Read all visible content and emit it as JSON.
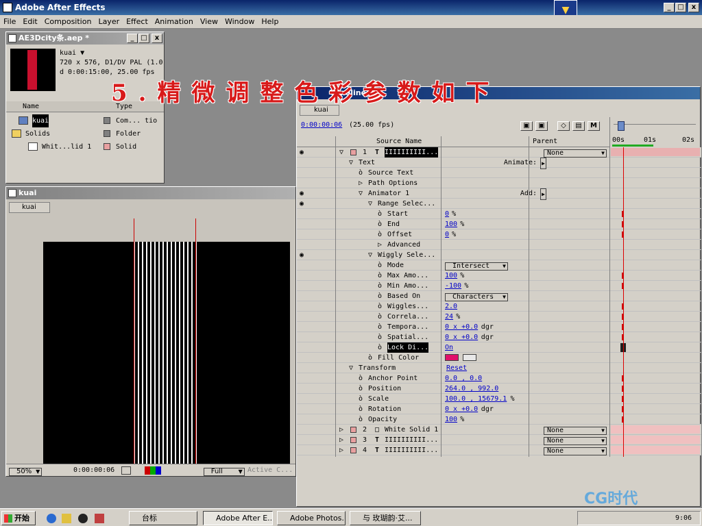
{
  "app": {
    "title": "Adobe After Effects"
  },
  "menu": [
    "File",
    "Edit",
    "Composition",
    "Layer",
    "Effect",
    "Animation",
    "View",
    "Window",
    "Help"
  ],
  "overlay_caption": "5.精微调整色彩参数如下",
  "project": {
    "title": "AE3Dcity条.aep *",
    "comp_name": "kuai ▼",
    "comp_info1": "720 x 576, D1/DV PAL (1.0",
    "comp_info2": "d 0:00:15:00, 25.00 fps",
    "col_name": "Name",
    "col_type": "Type",
    "items": [
      {
        "name": "kuai",
        "type": "Com... tio"
      },
      {
        "name": "Solids",
        "type": "Folder"
      },
      {
        "name": "Whit...lid 1",
        "type": "Solid"
      }
    ]
  },
  "comp": {
    "title": "kuai",
    "tab": "kuai",
    "zoom": "50%",
    "time": "0:00:00:06",
    "resolution": "Full",
    "camera": "Active C..."
  },
  "timeline": {
    "title": "Timeline",
    "tab": "kuai",
    "time": "0:00:00:06",
    "fps": "(25.00 fps)",
    "col_source": "Source Name",
    "col_parent": "Parent",
    "ruler": [
      "00s",
      "01s",
      "02s"
    ],
    "rows": [
      {
        "kind": "layer",
        "num": "1",
        "name": "IIIIIIIIII...",
        "parent": "None",
        "indent": 0
      },
      {
        "kind": "prop",
        "label": "Text",
        "indent": 1,
        "extra": "Animate:"
      },
      {
        "kind": "prop",
        "label": "Source Text",
        "indent": 2
      },
      {
        "kind": "prop",
        "label": "Path Options",
        "indent": 2
      },
      {
        "kind": "prop",
        "label": "Animator 1",
        "indent": 2,
        "extra": "Add:"
      },
      {
        "kind": "prop",
        "label": "Range Selec...",
        "indent": 3
      },
      {
        "kind": "prop",
        "label": "Start",
        "indent": 4,
        "value": "0",
        "unit": "%"
      },
      {
        "kind": "prop",
        "label": "End",
        "indent": 4,
        "value": "100",
        "unit": "%"
      },
      {
        "kind": "prop",
        "label": "Offset",
        "indent": 4,
        "value": "0",
        "unit": "%"
      },
      {
        "kind": "prop",
        "label": "Advanced",
        "indent": 4
      },
      {
        "kind": "prop",
        "label": "Wiggly Sele...",
        "indent": 3
      },
      {
        "kind": "prop",
        "label": "Mode",
        "indent": 4,
        "dropdown": "Intersect"
      },
      {
        "kind": "prop",
        "label": "Max Amo...",
        "indent": 4,
        "value": "100",
        "unit": "%"
      },
      {
        "kind": "prop",
        "label": "Min Amo...",
        "indent": 4,
        "value": "-100",
        "unit": "%"
      },
      {
        "kind": "prop",
        "label": "Based On",
        "indent": 4,
        "dropdown": "Characters"
      },
      {
        "kind": "prop",
        "label": "Wiggles...",
        "indent": 4,
        "value": "2.0",
        "unit": ""
      },
      {
        "kind": "prop",
        "label": "Correla...",
        "indent": 4,
        "value": "24",
        "unit": "%"
      },
      {
        "kind": "prop",
        "label": "Tempora...",
        "indent": 4,
        "value": "0 x +0.0",
        "unit": "dgr"
      },
      {
        "kind": "prop",
        "label": "Spatial...",
        "indent": 4,
        "value": "0 x +0.0",
        "unit": "dgr"
      },
      {
        "kind": "prop",
        "label": "Lock Di...",
        "indent": 4,
        "value": "On",
        "unit": "",
        "selected": true
      },
      {
        "kind": "prop",
        "label": "Fill Color",
        "indent": 3,
        "swatch": "#e0106a"
      },
      {
        "kind": "prop",
        "label": "Transform",
        "indent": 1,
        "extra2": "Reset"
      },
      {
        "kind": "prop",
        "label": "Anchor Point",
        "indent": 2,
        "value": "0.0 , 0.0",
        "unit": ""
      },
      {
        "kind": "prop",
        "label": "Position",
        "indent": 2,
        "value": "264.0 , 992.0",
        "unit": ""
      },
      {
        "kind": "prop",
        "label": "Scale",
        "indent": 2,
        "value": "100.0 , 15679.1",
        "unit": "%"
      },
      {
        "kind": "prop",
        "label": "Rotation",
        "indent": 2,
        "value": "0 x +0.0",
        "unit": "dgr"
      },
      {
        "kind": "prop",
        "label": "Opacity",
        "indent": 2,
        "value": "100",
        "unit": "%"
      },
      {
        "kind": "layer",
        "num": "2",
        "name": "White Solid 1",
        "parent": "None",
        "indent": 0
      },
      {
        "kind": "layer",
        "num": "3",
        "name": "IIIIIIIIII...",
        "parent": "None",
        "indent": 0
      },
      {
        "kind": "layer",
        "num": "4",
        "name": "IIIIIIIIII...",
        "parent": "None",
        "indent": 0
      }
    ]
  },
  "taskbar": {
    "start": "开始",
    "items": [
      "台标",
      "Adobe After E...",
      "Adobe Photos...",
      "与 玫瑚韵·艾..."
    ],
    "clock": "9:06"
  },
  "watermark": "CG时代",
  "colors": {
    "accent": "#0a246a",
    "layer_red": "#e8a0a0",
    "fill": "#e0106a"
  }
}
